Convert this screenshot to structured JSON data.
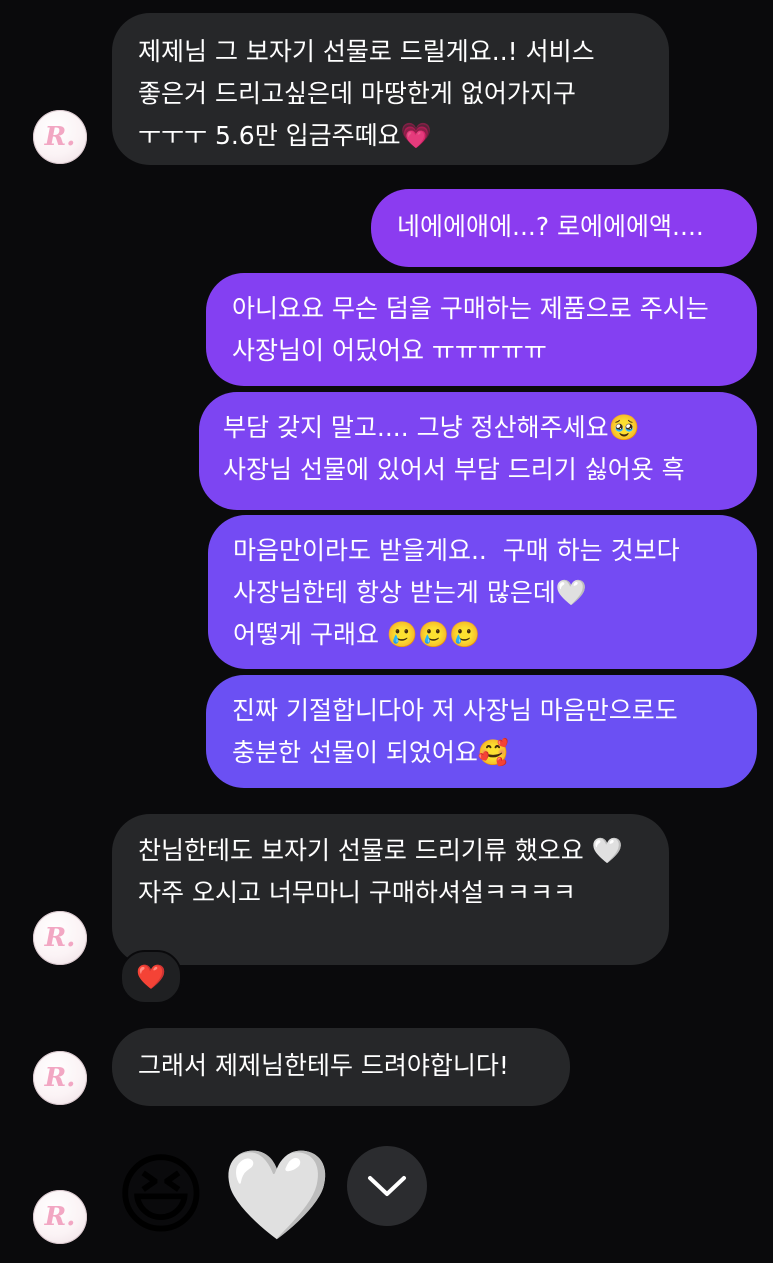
{
  "messages": [
    {
      "side": "in",
      "text": "제제님 그 보자기 선물로 드릴게요..! 서비스 좋은거 드리고싶은데 마땅한게 없어가지구 ㅜㅜㅜ 5.6만 입금주떼요💗"
    },
    {
      "side": "out",
      "text": "네에에애에...? 로에에에액...."
    },
    {
      "side": "out",
      "text": "아니요요 무슨 덤을 구매하는 제품으로 주시는 사장님이 어딨어요 ㅠㅠㅠㅠㅠ"
    },
    {
      "side": "out",
      "text": "부담 갖지 말고.... 그냥 정산해주세요🥹\n사장님 선물에 있어서 부담 드리기 싫어욧 흑"
    },
    {
      "side": "out",
      "text": "마음만이라도 받을게요..  구매 하는 것보다 사장님한테 항상 받는게 많은데🤍\n어떻게 구래요 🥲🥲🥲"
    },
    {
      "side": "out",
      "text": "진짜 기절합니다아 저 사장님 마음만으로도 충분한 선물이 되었어요🥰"
    },
    {
      "side": "in",
      "text": "찬님한테도 보자기 선물로 드리기류 했오요 🤍 자주 오시고 너무마니 구매하셔설ㅋㅋㅋㅋ"
    },
    {
      "side": "in",
      "text": "그래서 제제님한테두 드려야합니다!"
    }
  ],
  "reaction": "❤️",
  "avatar_text": "R.",
  "emoji_message": [
    "😆",
    "🤍"
  ],
  "icons": {
    "scroll_down": "chevron-down-icon",
    "reaction": "heart-icon"
  },
  "colors": {
    "background": "#0a0a0c",
    "incoming": "#262729",
    "outgoing": "#8b3cf0"
  }
}
